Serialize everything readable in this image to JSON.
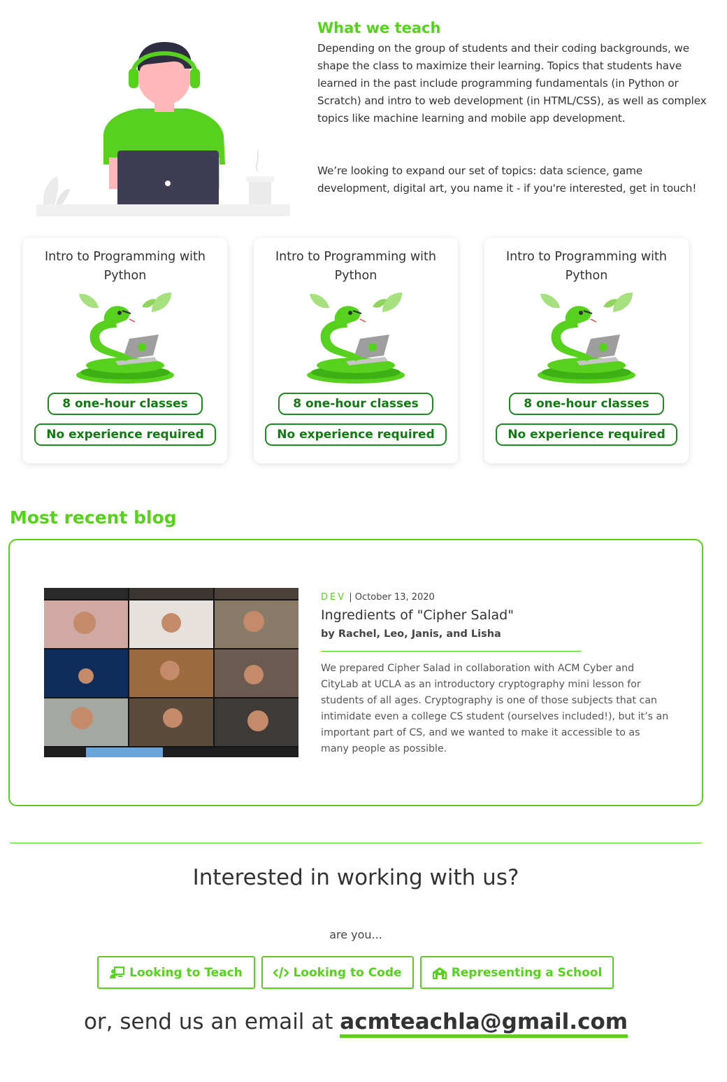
{
  "colors": {
    "accent": "#57d11d",
    "pill_green": "#137a13",
    "text": "#333333"
  },
  "teach": {
    "title": "What we teach",
    "paragraph1": "Depending on the group of students and their coding backgrounds, we shape the class to maximize their learning. Topics that students have learned in the past include programming fundamentals (in Python or Scratch) and intro to web development (in HTML/CSS), as well as complex topics like machine learning and mobile app development.",
    "paragraph2": "We’re looking to expand our set of topics: data science, game development, digital art, you name it - if you're interested, get in touch!"
  },
  "courses": [
    {
      "title": "Intro to Programming with Python",
      "badge1": "8 one-hour classes",
      "badge2": "No experience required"
    },
    {
      "title": "Intro to Programming with Python",
      "badge1": "8 one-hour classes",
      "badge2": "No experience required"
    },
    {
      "title": "Intro to Programming with Python",
      "badge1": "8 one-hour classes",
      "badge2": "No experience required"
    }
  ],
  "blog": {
    "heading": "Most recent blog",
    "tag": "DEV",
    "date": "October 13, 2020",
    "title": "Ingredients of \"Cipher Salad\"",
    "authors": "by Rachel, Leo, Janis, and Lisha",
    "excerpt": "We prepared Cipher Salad in collaboration with ACM Cyber and CityLab at UCLA as an introductory cryptography mini lesson for students of all ages. Cryptography is one of those subjects that can intimidate even a college CS student (ourselves included!), but it’s an important part of CS, and we wanted to make it accessible to as many people as possible."
  },
  "cta": {
    "title": "Interested in working with us?",
    "subtitle": "are you...",
    "buttons": [
      {
        "label": "Looking to Teach",
        "icon": "chalkboard-teacher-icon"
      },
      {
        "label": "Looking to Code",
        "icon": "code-icon"
      },
      {
        "label": "Representing a School",
        "icon": "school-icon"
      }
    ],
    "email_prefix": "or, send us an email at ",
    "email": "acmteachla@gmail.com"
  }
}
